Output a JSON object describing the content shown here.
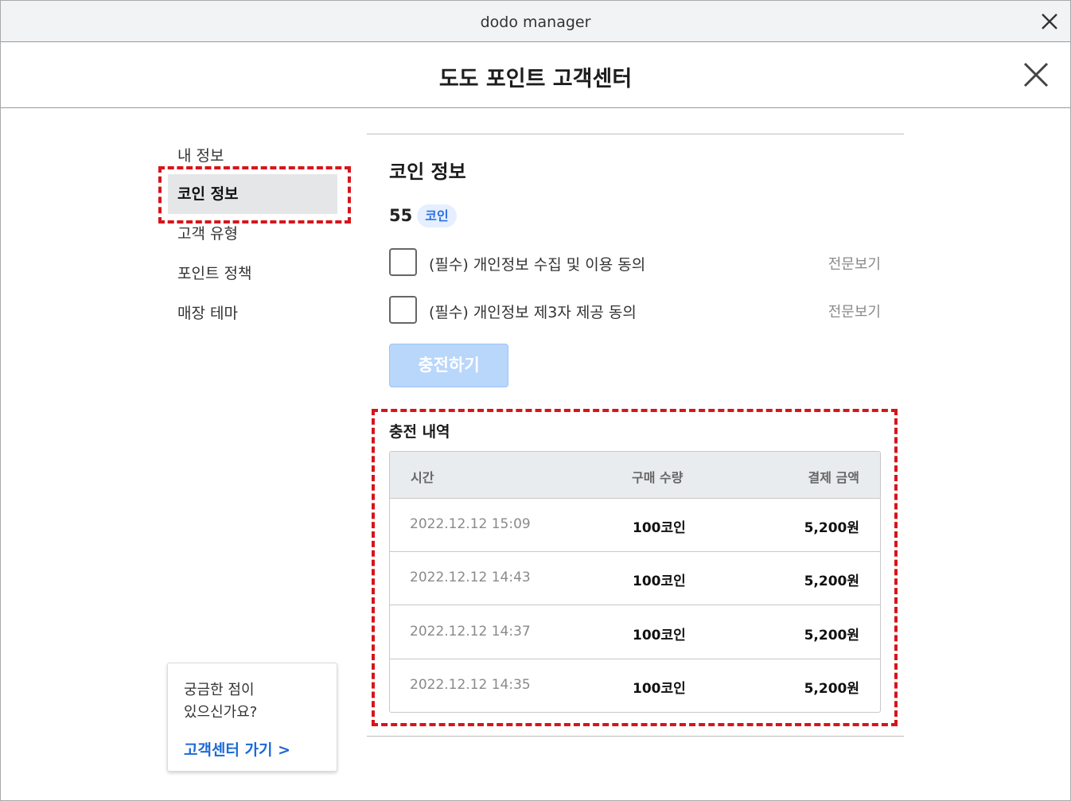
{
  "window": {
    "title": "dodo manager"
  },
  "dialog": {
    "title": "도도 포인트 고객센터"
  },
  "sidebar": {
    "items": [
      {
        "label": "내 정보"
      },
      {
        "label": "코인 정보"
      },
      {
        "label": "고객 유형"
      },
      {
        "label": "포인트 정책"
      },
      {
        "label": "매장 테마"
      }
    ],
    "active_index": 1
  },
  "help": {
    "question_line1": "궁금한 점이",
    "question_line2": "있으신가요?",
    "link": "고객센터 가기 >"
  },
  "main": {
    "title": "코인 정보",
    "coin_amount": "55",
    "coin_unit": "코인",
    "agreements": [
      {
        "label": "(필수) 개인정보 수집 및 이용 동의",
        "view": "전문보기",
        "checked": false
      },
      {
        "label": "(필수) 개인정보 제3자 제공 동의",
        "view": "전문보기",
        "checked": false
      }
    ],
    "charge_button": "충전하기",
    "history": {
      "title": "충전 내역",
      "headers": {
        "time": "시간",
        "qty": "구매 수량",
        "amount": "결제 금액"
      },
      "rows": [
        {
          "time": "2022.12.12 15:09",
          "qty": "100코인",
          "amount": "5,200원"
        },
        {
          "time": "2022.12.12 14:43",
          "qty": "100코인",
          "amount": "5,200원"
        },
        {
          "time": "2022.12.12 14:37",
          "qty": "100코인",
          "amount": "5,200원"
        },
        {
          "time": "2022.12.12 14:35",
          "qty": "100코인",
          "amount": "5,200원"
        }
      ]
    }
  },
  "colors": {
    "accent": "#2d6fe0",
    "link": "#1d69d6",
    "highlight": "#d6151b",
    "button_disabled": "#b9d6fb"
  }
}
